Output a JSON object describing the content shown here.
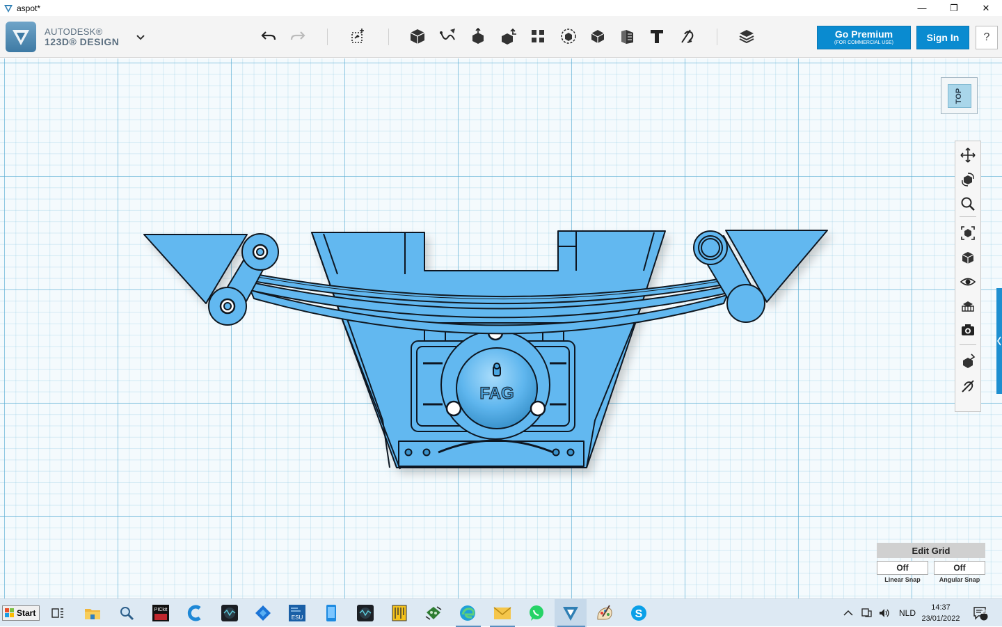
{
  "window": {
    "title": "aspot*",
    "minimize": "—",
    "maximize": "❐",
    "close": "✕"
  },
  "brand": {
    "line1": "AUTODESK®",
    "line2": "123D® DESIGN"
  },
  "account": {
    "premium_label": "Go Premium",
    "premium_sub": "(FOR COMMERCIAL USE)",
    "signin_label": "Sign In",
    "help_label": "?"
  },
  "viewcube": {
    "face_label": "TOP"
  },
  "model": {
    "badge_text": "FAG"
  },
  "grid_panel": {
    "title": "Edit Grid",
    "linear_snap_value": "Off",
    "angular_snap_value": "Off",
    "linear_snap_label": "Linear Snap",
    "angular_snap_label": "Angular Snap"
  },
  "taskbar": {
    "start_label": "Start",
    "language": "NLD",
    "time": "14:37",
    "date": "23/01/2022",
    "notification_count": "11"
  },
  "colors": {
    "accent": "#0a8bd0",
    "model_fill": "#62b8f0",
    "model_stroke": "#101820",
    "grid_major": "#55aad2"
  }
}
